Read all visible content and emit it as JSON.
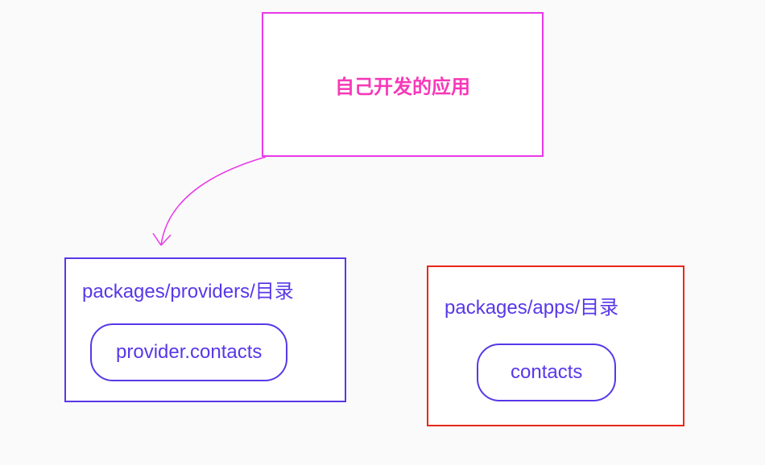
{
  "top": {
    "label": "自己开发的应用"
  },
  "bottomLeft": {
    "title": "packages/providers/目录",
    "inner": "provider.contacts"
  },
  "bottomRight": {
    "title": "packages/apps/目录",
    "inner": "contacts"
  },
  "colors": {
    "magenta": "#e838e8",
    "pink": "#f738b8",
    "purple": "#5838e8",
    "red": "#e82818"
  }
}
